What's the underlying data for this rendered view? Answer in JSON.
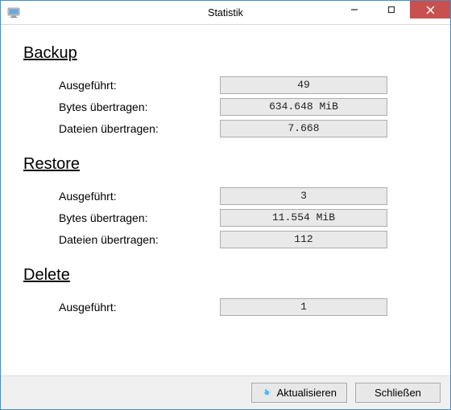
{
  "window": {
    "title": "Statistik"
  },
  "sections": {
    "backup": {
      "header": "Backup",
      "rows": {
        "executed_label": "Ausgeführt:",
        "executed_value": "49",
        "bytes_label": "Bytes übertragen:",
        "bytes_value": "634.648 MiB",
        "files_label": "Dateien übertragen:",
        "files_value": "7.668"
      }
    },
    "restore": {
      "header": "Restore",
      "rows": {
        "executed_label": "Ausgeführt:",
        "executed_value": "3",
        "bytes_label": "Bytes übertragen:",
        "bytes_value": "11.554 MiB",
        "files_label": "Dateien übertragen:",
        "files_value": "112"
      }
    },
    "delete": {
      "header": "Delete",
      "rows": {
        "executed_label": "Ausgeführt:",
        "executed_value": "1"
      }
    }
  },
  "footer": {
    "refresh_label": "Aktualisieren",
    "close_label": "Schließen"
  },
  "icons": {
    "app": "monitor-icon",
    "refresh": "refresh-icon"
  }
}
